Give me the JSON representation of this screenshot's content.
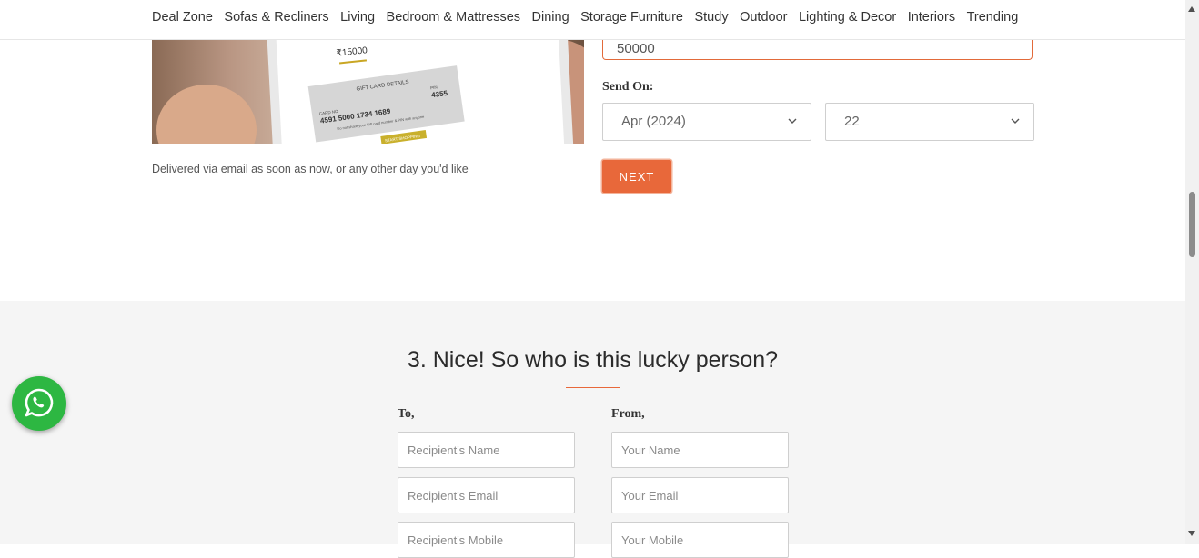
{
  "nav": {
    "items": [
      "Deal Zone",
      "Sofas & Recliners",
      "Living",
      "Bedroom & Mattresses",
      "Dining",
      "Storage Furniture",
      "Study",
      "Outdoor",
      "Lighting & Decor",
      "Interiors",
      "Trending"
    ]
  },
  "gift_card_image": {
    "amount": "₹15000",
    "details_heading": "GIFT CARD DETAILS",
    "card_no_label": "CARD NO",
    "card_number": "4591 5000 1734 1689",
    "pin_label": "PIN",
    "pin": "4355",
    "note": "Do not share your Gift card number & PIN with anyone",
    "cta": "START SHOPPING"
  },
  "caption": "Delivered via email as soon as now, or any other day you'd like",
  "amount_field": {
    "value": "50000"
  },
  "send_on": {
    "label": "Send On:",
    "month_value": "Apr (2024)",
    "day_value": "22"
  },
  "next_button": "NEXT",
  "recipient_section": {
    "title": "3. Nice! So who is this lucky person?",
    "to_label": "To,",
    "from_label": "From,",
    "to_fields": {
      "name_placeholder": "Recipient's Name",
      "email_placeholder": "Recipient's Email",
      "mobile_placeholder": "Recipient's Mobile"
    },
    "from_fields": {
      "name_placeholder": "Your Name",
      "email_placeholder": "Your Email",
      "mobile_placeholder": "Your Mobile"
    }
  },
  "colors": {
    "accent": "#e8683a",
    "whatsapp": "#2db742",
    "section_bg": "#f5f5f5"
  }
}
